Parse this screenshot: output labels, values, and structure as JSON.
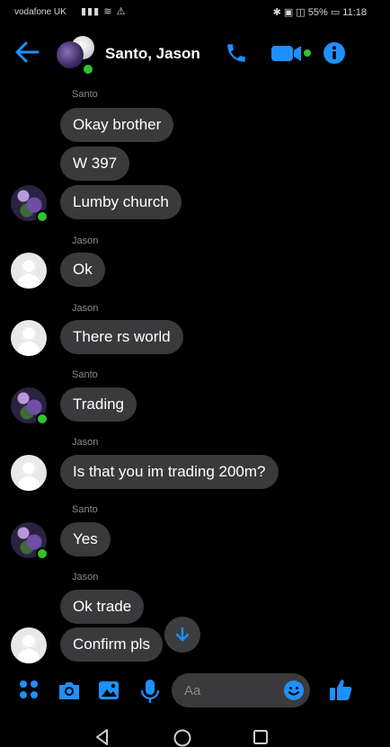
{
  "status_bar": {
    "carrier": "vodafone UK",
    "battery_percent": "55%",
    "time": "11:18"
  },
  "header": {
    "title": "Santo, Jason",
    "back_icon": "arrow-left-icon",
    "call_icon": "phone-icon",
    "video_icon": "video-camera-icon",
    "info_icon": "info-icon"
  },
  "messages": [
    {
      "sender": "Santo",
      "text": "Okay brother"
    },
    {
      "sender": "",
      "text": "W 397"
    },
    {
      "sender": "",
      "text": "Lumby church"
    },
    {
      "sender": "Jason",
      "text": "Ok"
    },
    {
      "sender": "Jason",
      "text": "There rs world"
    },
    {
      "sender": "Santo",
      "text": "Trading"
    },
    {
      "sender": "Jason",
      "text": "Is that you im trading 200m?"
    },
    {
      "sender": "Santo",
      "text": "Yes"
    },
    {
      "sender": "Jason",
      "text": "Ok trade"
    },
    {
      "sender": "",
      "text": "Confirm pls"
    }
  ],
  "composer": {
    "placeholder": "Aa",
    "icons": [
      "apps-icon",
      "camera-icon",
      "gallery-icon",
      "microphone-icon",
      "emoji-icon",
      "thumbs-up-icon"
    ]
  },
  "scroll_down_icon": "arrow-down-icon",
  "nav_bar": [
    "back-triangle-icon",
    "home-circle-icon",
    "recents-square-icon"
  ],
  "colors": {
    "accent": "#1e90ff",
    "bubble": "#3a3a3c",
    "background": "#000000",
    "online": "#31c331"
  }
}
